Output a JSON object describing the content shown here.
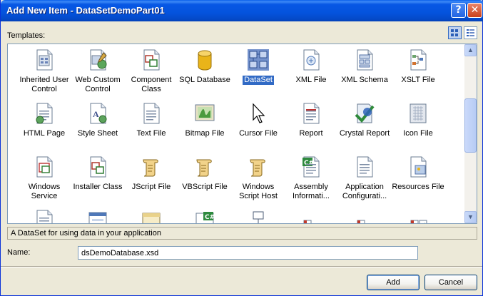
{
  "window": {
    "title": "Add New Item - DataSetDemoPart01"
  },
  "labels": {
    "templates": "Templates:",
    "name": "Name:"
  },
  "templates": [
    {
      "label": "Inherited User Control",
      "icon": "inherited-user-control-icon"
    },
    {
      "label": "Web Custom Control",
      "icon": "web-custom-control-icon"
    },
    {
      "label": "Component Class",
      "icon": "component-class-icon"
    },
    {
      "label": "SQL Database",
      "icon": "sql-database-icon"
    },
    {
      "label": "DataSet",
      "icon": "dataset-icon",
      "selected": true
    },
    {
      "label": "XML File",
      "icon": "xml-file-icon"
    },
    {
      "label": "XML Schema",
      "icon": "xml-schema-icon"
    },
    {
      "label": "XSLT File",
      "icon": "xslt-file-icon"
    },
    {
      "label": "HTML Page",
      "icon": "html-page-icon"
    },
    {
      "label": "Style Sheet",
      "icon": "style-sheet-icon"
    },
    {
      "label": "Text File",
      "icon": "text-file-icon"
    },
    {
      "label": "Bitmap File",
      "icon": "bitmap-file-icon"
    },
    {
      "label": "Cursor File",
      "icon": "cursor-file-icon"
    },
    {
      "label": "Report",
      "icon": "report-icon"
    },
    {
      "label": "Crystal Report",
      "icon": "crystal-report-icon"
    },
    {
      "label": "Icon File",
      "icon": "icon-file-icon"
    },
    {
      "label": "Windows Service",
      "icon": "windows-service-icon"
    },
    {
      "label": "Installer Class",
      "icon": "installer-class-icon"
    },
    {
      "label": "JScript File",
      "icon": "jscript-file-icon"
    },
    {
      "label": "VBScript File",
      "icon": "vbscript-file-icon"
    },
    {
      "label": "Windows Script Host",
      "icon": "windows-script-host-icon"
    },
    {
      "label": "Assembly Informati...",
      "icon": "assembly-info-icon"
    },
    {
      "label": "Application Configurati...",
      "icon": "app-config-icon"
    },
    {
      "label": "Resources File",
      "icon": "resources-file-icon"
    },
    {
      "label": "",
      "icon": "document-icon"
    },
    {
      "label": "",
      "icon": "form-icon"
    },
    {
      "label": "",
      "icon": "toolbox-icon"
    },
    {
      "label": "",
      "icon": "csharp-file-icon"
    },
    {
      "label": "",
      "icon": "network-icon"
    },
    {
      "label": "",
      "icon": "cable-icon"
    },
    {
      "label": "",
      "icon": "cable-icon-2"
    },
    {
      "label": "",
      "icon": "checklist-icon"
    }
  ],
  "description": "A DataSet for using data in your application",
  "name_field": {
    "value": "dsDemoDatabase.xsd"
  },
  "buttons": {
    "add": "Add",
    "cancel": "Cancel"
  },
  "colors": {
    "title_bar": "#0453DD",
    "selection": "#316AC5",
    "window_bg": "#ECE9D8"
  }
}
